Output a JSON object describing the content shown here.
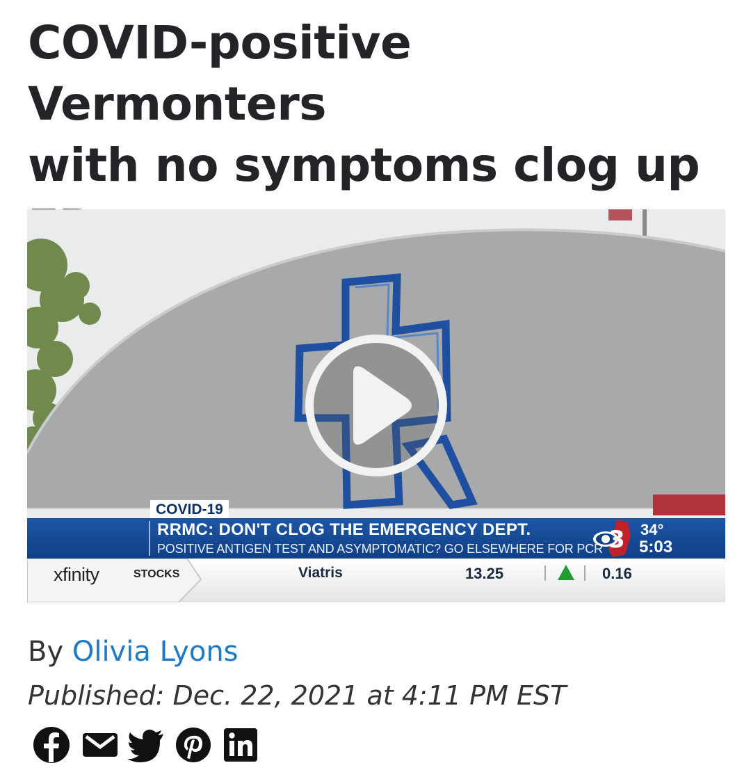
{
  "article": {
    "headline_lines": [
      "COVID-positive Vermonters",
      "with no symptoms clog up",
      "ERs"
    ],
    "byline_prefix": "By",
    "author": "Olivia Lyons",
    "published": "Published: Dec. 22, 2021 at 4:11 PM EST"
  },
  "video": {
    "tag": "COVID-19",
    "headline": "RRMC: DON'T CLOG THE EMERGENCY DEPT.",
    "subline": "POSITIVE ANTIGEN TEST AND ASYMPTOMATIC? GO ELSEWHERE FOR PCR",
    "channel_number": "3",
    "temperature": "34°",
    "time": "5:03",
    "ticker": {
      "brand": "xfinity",
      "section": "STOCKS",
      "name": "Viatris",
      "price": "13.25",
      "change": "0.16",
      "direction": "up"
    },
    "play_icon": "play-circle-icon"
  },
  "share": {
    "icons": [
      "facebook-icon",
      "email-icon",
      "twitter-icon",
      "pinterest-icon",
      "linkedin-icon"
    ]
  },
  "colors": {
    "headline": "#222428",
    "link": "#1e79c6",
    "news_bar": "#1d56a4",
    "ticker_up": "#1f9d2e"
  }
}
